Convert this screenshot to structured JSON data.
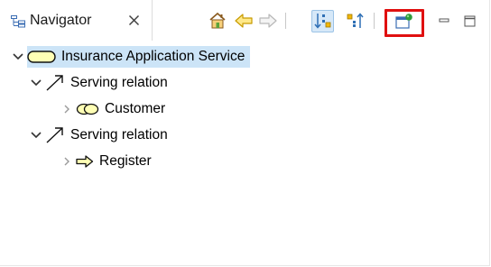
{
  "tab": {
    "label": "Navigator"
  },
  "tree": {
    "root": {
      "label": "Insurance Application Service"
    },
    "relation_1": {
      "label": "Serving relation"
    },
    "customer": {
      "label": "Customer"
    },
    "relation_2": {
      "label": "Serving relation"
    },
    "register": {
      "label": "Register"
    }
  },
  "colors": {
    "selection": "#cce4f7",
    "highlight": "#e01010",
    "arrow_yellow": "#f2d100",
    "service_fill": "#ffffb5"
  }
}
